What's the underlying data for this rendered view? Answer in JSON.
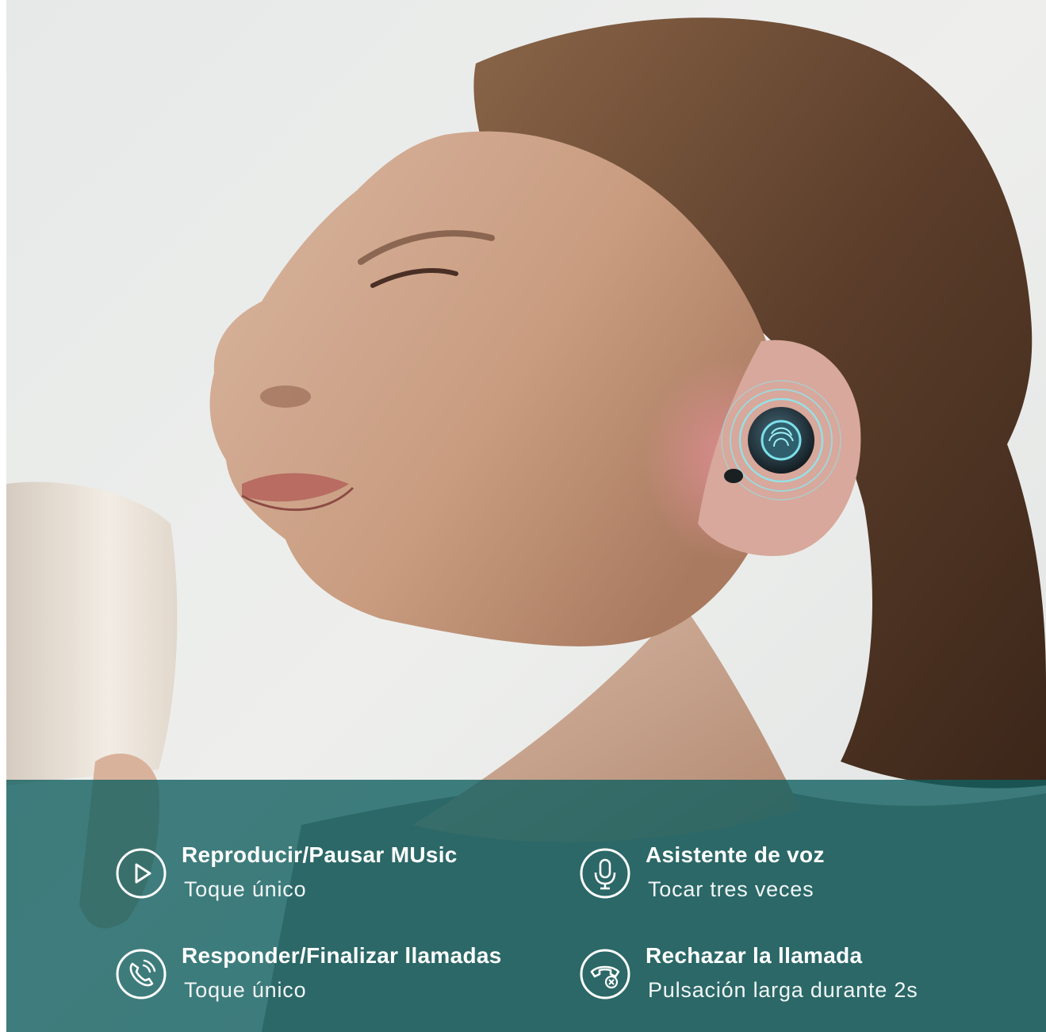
{
  "image": {
    "subject": "woman-with-wireless-earbud",
    "colors": {
      "panel": "#125f60",
      "text": "#ffffff",
      "touch_ring": "#6fd3e0",
      "earbud": "#1e2c35"
    }
  },
  "features": [
    {
      "title": "Reproducir/Pausar MUsic",
      "subtitle": "Toque único",
      "icon": "play-icon"
    },
    {
      "title": "Asistente de voz",
      "subtitle": "Tocar tres veces",
      "icon": "microphone-icon"
    },
    {
      "title": "Responder/Finalizar llamadas",
      "subtitle": "Toque único",
      "icon": "phone-call-icon"
    },
    {
      "title": "Rechazar la llamada",
      "subtitle": "Pulsación larga durante 2s",
      "icon": "reject-call-icon"
    }
  ]
}
